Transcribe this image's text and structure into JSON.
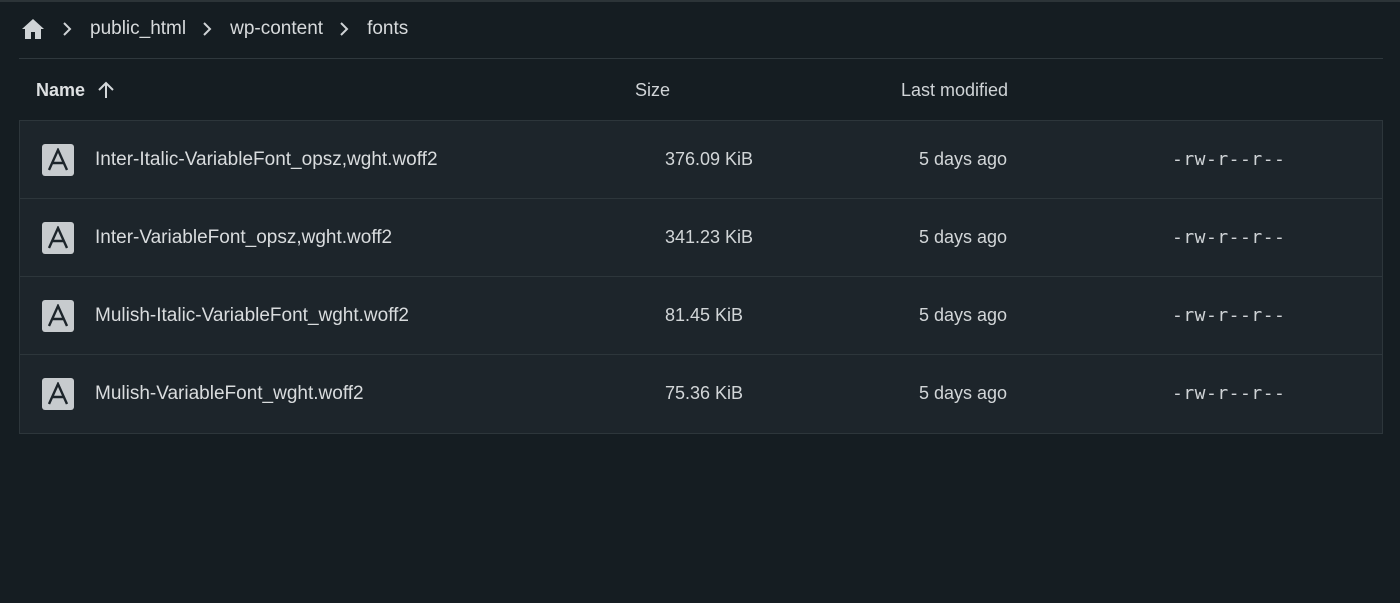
{
  "breadcrumb": {
    "home_icon": "home-icon",
    "separator_icon": "chevron-right-icon",
    "items": [
      "public_html",
      "wp-content",
      "fonts"
    ]
  },
  "table": {
    "columns": {
      "name": "Name",
      "size": "Size",
      "modified": "Last modified"
    },
    "sort_icon": "arrow-up-icon",
    "file_icon": "font-file-icon",
    "rows": [
      {
        "name": "Inter-Italic-VariableFont_opsz,wght.woff2",
        "size": "376.09 KiB",
        "modified": "5 days ago",
        "perms": "-rw-r--r--"
      },
      {
        "name": "Inter-VariableFont_opsz,wght.woff2",
        "size": "341.23 KiB",
        "modified": "5 days ago",
        "perms": "-rw-r--r--"
      },
      {
        "name": "Mulish-Italic-VariableFont_wght.woff2",
        "size": "81.45 KiB",
        "modified": "5 days ago",
        "perms": "-rw-r--r--"
      },
      {
        "name": "Mulish-VariableFont_wght.woff2",
        "size": "75.36 KiB",
        "modified": "5 days ago",
        "perms": "-rw-r--r--"
      }
    ]
  },
  "colors": {
    "background": "#151d22",
    "row_background": "#1d252b",
    "border": "#2d363b",
    "text": "#d9dcde",
    "icon": "#c7cbce"
  }
}
